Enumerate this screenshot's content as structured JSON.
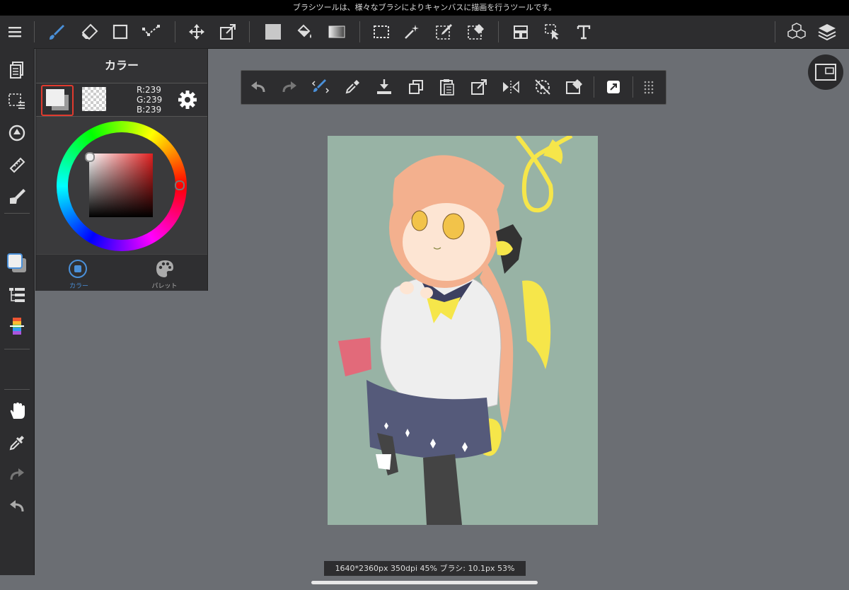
{
  "hint_text": "ブラシツールは、様々なブラシによりキャンバスに描画を行うツールです。",
  "color_panel": {
    "title": "カラー",
    "rgb": {
      "r": "R:239",
      "g": "G:239",
      "b": "B:239"
    },
    "tabs": [
      {
        "label": "カラー",
        "active": true
      },
      {
        "label": "パレット",
        "active": false
      }
    ],
    "foreground_color": "#efefef"
  },
  "accent_color": "#4a90d9",
  "canvas_background": "#98b3a5",
  "status_info": "1640*2360px 350dpi 45% ブラシ: 10.1px 53%",
  "top_tools": [
    "menu-icon",
    "brush-icon",
    "eraser-icon",
    "shape-icon",
    "dot-line-icon",
    "move-icon",
    "transform-icon",
    "fill-color-icon",
    "bucket-icon",
    "gradient-icon",
    "select-rect-icon",
    "magic-wand-icon",
    "select-pen-icon",
    "select-eraser-icon",
    "layout-icon",
    "select-pointer-icon",
    "text-icon",
    "3d-icon",
    "layers-icon"
  ],
  "side_tools": [
    "pages-icon",
    "selection-icon",
    "rotate-icon",
    "ruler-icon",
    "fill-pen-icon",
    "color-swatch-icon",
    "brush-list-icon",
    "color-bar-icon",
    "hand-icon",
    "eyedropper-icon",
    "redo-icon",
    "undo-icon"
  ],
  "command_tools": [
    "undo-icon",
    "redo-icon",
    "brush-snap-icon",
    "eyedropper-icon",
    "import-icon",
    "copy-icon",
    "paste-icon",
    "transform-icon",
    "flip-icon",
    "rotate-off-icon",
    "clear-icon",
    "share-icon",
    "grid-more-icon"
  ]
}
